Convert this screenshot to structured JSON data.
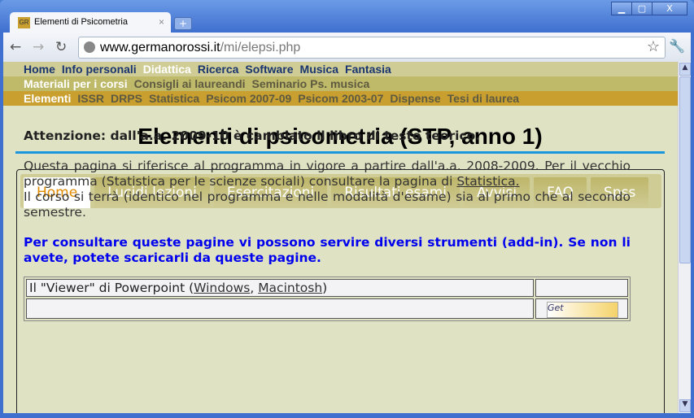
{
  "browser": {
    "tab_title": "Elementi di Psicometria",
    "favicon": "GR",
    "url_host": "www.germanorossi.it",
    "url_path": "/mi/elepsi.php"
  },
  "nav1": [
    "Home",
    "Info personali",
    "Didattica",
    "Ricerca",
    "Software",
    "Musica",
    "Fantasia"
  ],
  "nav2": [
    "Materiali per i corsi",
    "Consigli ai laureandi",
    "Seminario Ps. musica"
  ],
  "nav3": [
    "Elementi",
    "ISSR",
    "DRPS",
    "Statistica",
    "Psicom 2007-09",
    "Psicom 2003-07",
    "Dispense",
    "Tesi di laurea"
  ],
  "title": "Elementi di psicometria (STP, anno 1)",
  "tabs": [
    "Home",
    "Lucidi lezioni",
    "Esercitazioni",
    "Risultati esami",
    "Avvisi",
    "FAQ",
    "Spss"
  ],
  "content": {
    "warning": "Attenzione: dall'a.a. 2009-10 è cambiato il libro di testo teorico.",
    "p1a": "Questa pagina si riferisce al programma in vigore a partire dall'a.a. 2008-2009. Per il vecchio programma (Statistica per le scienze sociali) consultare la pagina di ",
    "p1link": "Statistica. ",
    "p2": "Il corso si terrà (identico nel programma e nelle modalità d'esame) sia al primo che al secondo semestre.",
    "tools": "Per consultare queste pagine vi possono servire diversi strumenti (add-in). Se non li avete, potete scaricarli da queste pagine."
  },
  "table": {
    "row1_a": "Il \"Viewer\" di Powerpoint (",
    "row1_l1": "Windows",
    "row1_sep": ", ",
    "row1_l2": "Macintosh",
    "row1_b": ")",
    "row2_img": "Get"
  }
}
